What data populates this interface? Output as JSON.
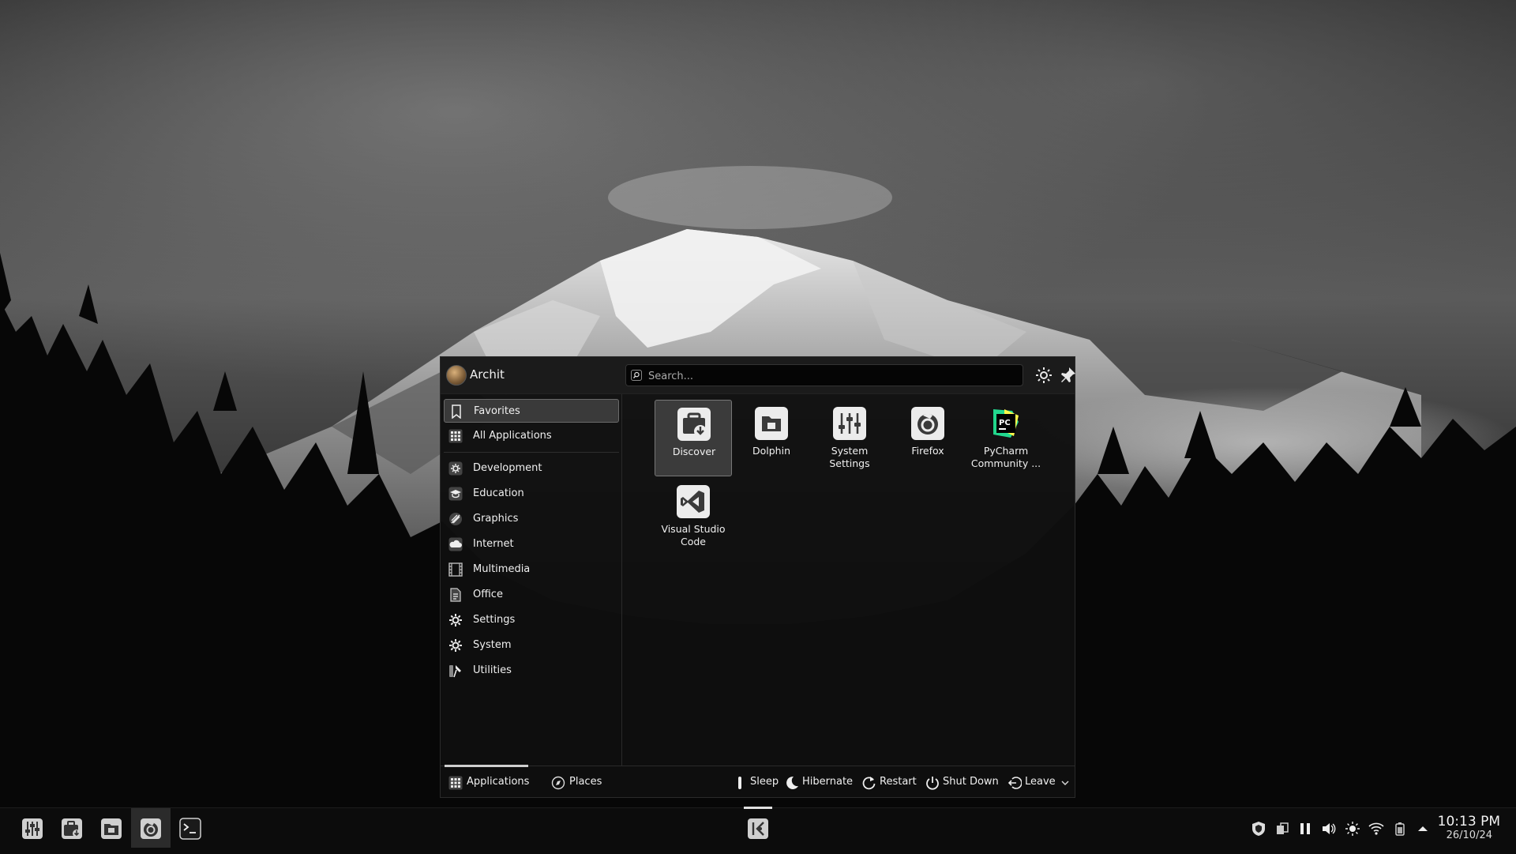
{
  "launcher": {
    "username": "Archit",
    "search_placeholder": "Search...",
    "categories": [
      {
        "label": "Favorites",
        "icon": "bookmark-icon",
        "active": true
      },
      {
        "label": "All Applications",
        "icon": "grid-icon"
      },
      {
        "label": "Development",
        "icon": "development-icon"
      },
      {
        "label": "Education",
        "icon": "education-icon"
      },
      {
        "label": "Graphics",
        "icon": "graphics-icon"
      },
      {
        "label": "Internet",
        "icon": "cloud-icon"
      },
      {
        "label": "Multimedia",
        "icon": "film-icon"
      },
      {
        "label": "Office",
        "icon": "document-icon"
      },
      {
        "label": "Settings",
        "icon": "gear-icon"
      },
      {
        "label": "System",
        "icon": "gear-icon"
      },
      {
        "label": "Utilities",
        "icon": "tools-icon"
      }
    ],
    "apps": [
      {
        "label": "Discover",
        "icon": "discover-icon",
        "active": true
      },
      {
        "label": "Dolphin",
        "icon": "dolphin-folder-icon"
      },
      {
        "label": "System\nSettings",
        "icon": "system-settings-icon"
      },
      {
        "label": "Firefox",
        "icon": "firefox-icon"
      },
      {
        "label": "PyCharm\nCommunity ...",
        "icon": "pycharm-icon"
      },
      {
        "label": "Visual Studio\nCode",
        "icon": "vscode-icon"
      }
    ],
    "footer_tabs": [
      {
        "label": "Applications",
        "icon": "grid-icon",
        "active": true
      },
      {
        "label": "Places",
        "icon": "compass-icon"
      }
    ],
    "power": {
      "sleep": "Sleep",
      "hibernate": "Hibernate",
      "restart": "Restart",
      "shutdown": "Shut Down",
      "leave": "Leave"
    }
  },
  "taskbar": {
    "clock_time": "10:13 PM",
    "clock_date": "26/10/24"
  }
}
